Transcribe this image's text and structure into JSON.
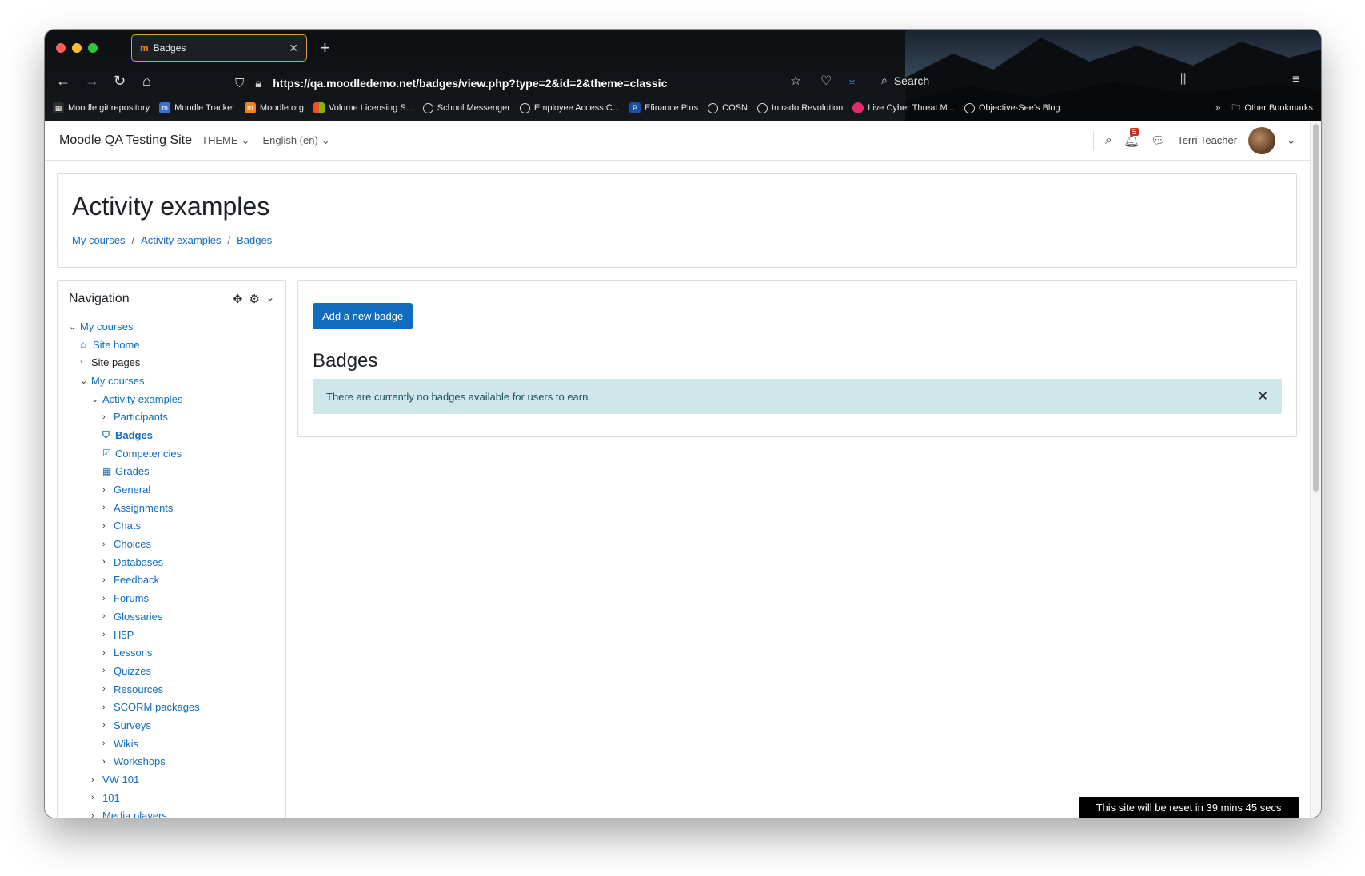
{
  "browser": {
    "tab_title": "Badges",
    "tab_favicon": "m",
    "url": "https://qa.moodledemo.net/badges/view.php?type=2&id=2&theme=classic",
    "search_label": "Search",
    "bookmarks": [
      {
        "label": "Moodle git repository",
        "color": "#2d2d2d"
      },
      {
        "label": "Moodle Tracker",
        "color": "#3c6fd8"
      },
      {
        "label": "Moodle.org",
        "color": "#f98012"
      },
      {
        "label": "Volume Licensing S...",
        "color": "#f25022"
      },
      {
        "label": "School Messenger",
        "color": "globe"
      },
      {
        "label": "Employee Access C...",
        "color": "globe"
      },
      {
        "label": "Efinance Plus",
        "color": "#1b4fa0"
      },
      {
        "label": "COSN",
        "color": "globe"
      },
      {
        "label": "Intrado Revolution",
        "color": "globe"
      },
      {
        "label": "Live Cyber Threat M...",
        "color": "#e02b6c"
      },
      {
        "label": "Objective-See's Blog",
        "color": "globe"
      }
    ],
    "other_bookmarks": "Other Bookmarks"
  },
  "topnav": {
    "site_name": "Moodle QA Testing Site",
    "theme_menu": "THEME",
    "language_menu": "English (en)",
    "notification_count": "5",
    "user_name": "Terri Teacher"
  },
  "header": {
    "title": "Activity examples",
    "breadcrumb": [
      "My courses",
      "Activity examples",
      "Badges"
    ]
  },
  "navigation": {
    "title": "Navigation",
    "items": [
      {
        "label": "My courses",
        "indent": 0,
        "icon": "chevron-down",
        "style": "link"
      },
      {
        "label": "Site home",
        "indent": 1,
        "icon": "home",
        "style": "link"
      },
      {
        "label": "Site pages",
        "indent": 1,
        "icon": "chevron-right",
        "style": "dark"
      },
      {
        "label": "My courses",
        "indent": 1,
        "icon": "chevron-down",
        "style": "link"
      },
      {
        "label": "Activity examples",
        "indent": 2,
        "icon": "chevron-down",
        "style": "link"
      },
      {
        "label": "Participants",
        "indent": 3,
        "icon": "chevron-right",
        "style": "link"
      },
      {
        "label": "Badges",
        "indent": 3,
        "icon": "shield",
        "style": "bold"
      },
      {
        "label": "Competencies",
        "indent": 3,
        "icon": "checkbox",
        "style": "link"
      },
      {
        "label": "Grades",
        "indent": 3,
        "icon": "table",
        "style": "link"
      },
      {
        "label": "General",
        "indent": 3,
        "icon": "chevron-right",
        "style": "link"
      },
      {
        "label": "Assignments",
        "indent": 3,
        "icon": "chevron-right",
        "style": "link"
      },
      {
        "label": "Chats",
        "indent": 3,
        "icon": "chevron-right",
        "style": "link"
      },
      {
        "label": "Choices",
        "indent": 3,
        "icon": "chevron-right",
        "style": "link"
      },
      {
        "label": "Databases",
        "indent": 3,
        "icon": "chevron-right",
        "style": "link"
      },
      {
        "label": "Feedback",
        "indent": 3,
        "icon": "chevron-right",
        "style": "link"
      },
      {
        "label": "Forums",
        "indent": 3,
        "icon": "chevron-right",
        "style": "link"
      },
      {
        "label": "Glossaries",
        "indent": 3,
        "icon": "chevron-right",
        "style": "link"
      },
      {
        "label": "H5P",
        "indent": 3,
        "icon": "chevron-right",
        "style": "link"
      },
      {
        "label": "Lessons",
        "indent": 3,
        "icon": "chevron-right",
        "style": "link"
      },
      {
        "label": "Quizzes",
        "indent": 3,
        "icon": "chevron-right",
        "style": "link"
      },
      {
        "label": "Resources",
        "indent": 3,
        "icon": "chevron-right",
        "style": "link"
      },
      {
        "label": "SCORM packages",
        "indent": 3,
        "icon": "chevron-right",
        "style": "link"
      },
      {
        "label": "Surveys",
        "indent": 3,
        "icon": "chevron-right",
        "style": "link"
      },
      {
        "label": "Wikis",
        "indent": 3,
        "icon": "chevron-right",
        "style": "link"
      },
      {
        "label": "Workshops",
        "indent": 3,
        "icon": "chevron-right",
        "style": "link"
      },
      {
        "label": "VW 101",
        "indent": 2,
        "icon": "chevron-right",
        "style": "link"
      },
      {
        "label": "101",
        "indent": 2,
        "icon": "chevron-right",
        "style": "link"
      },
      {
        "label": "Media players",
        "indent": 2,
        "icon": "chevron-right",
        "style": "link"
      }
    ]
  },
  "main": {
    "add_badge_button": "Add a new badge",
    "heading": "Badges",
    "alert_text": "There are currently no badges available for users to earn."
  },
  "footer": {
    "reset_notice": "This site will be reset in 39 mins 45 secs"
  },
  "colors": {
    "primary": "#0f6cbf",
    "alert_bg": "#cfe6ea",
    "notification_badge": "#ca3120"
  }
}
